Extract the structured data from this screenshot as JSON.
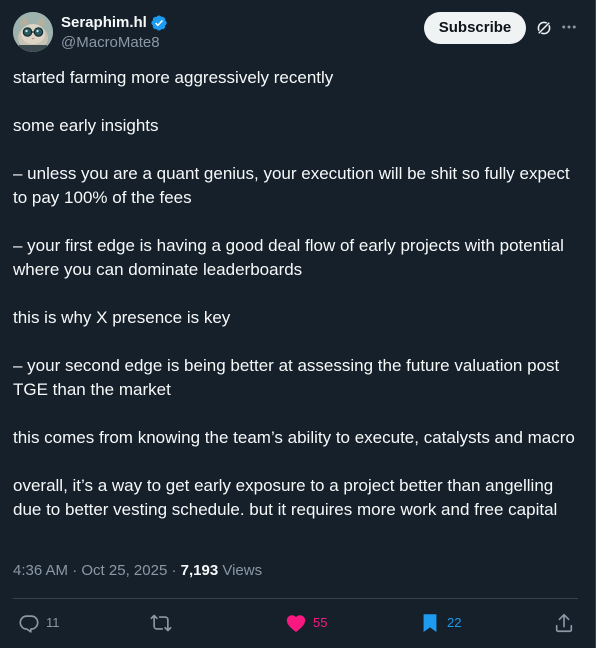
{
  "author": {
    "display_name": "Seraphim.hl",
    "handle": "@MacroMate8",
    "verified": true,
    "avatar_icon": "cat-with-glasses-avatar"
  },
  "header": {
    "subscribe_label": "Subscribe",
    "grok_icon": "grok-icon",
    "more_icon": "more-icon"
  },
  "body": [
    "started farming more aggressively recently",
    "",
    "some early insights",
    "",
    "– unless you are a quant genius, your execution will be shit so fully expect to pay 100% of the fees",
    "",
    "– your first edge is having a good deal flow of early projects with potential where you can dominate leaderboards",
    "",
    "this is why X presence is key",
    "",
    "– your second edge is being better at assessing the future valuation post TGE than the market",
    "",
    "this comes from knowing the team’s ability to execute, catalysts and macro",
    "",
    "overall, it’s a way to get early exposure to a project better than angelling due to better vesting schedule. but it requires more work and free capital"
  ],
  "meta": {
    "time": "4:36 AM",
    "date": "Oct 25, 2025",
    "separator": "·",
    "views_count": "7,193",
    "views_label": "Views"
  },
  "actions": {
    "replies": "11",
    "reposts": "",
    "likes": "55",
    "bookmarks": "22"
  },
  "colors": {
    "background": "#15202b",
    "text": "#f7f9f9",
    "muted": "#8b98a5",
    "like": "#f91880",
    "bookmark": "#1d9bf0",
    "verified": "#1d9bf0"
  }
}
